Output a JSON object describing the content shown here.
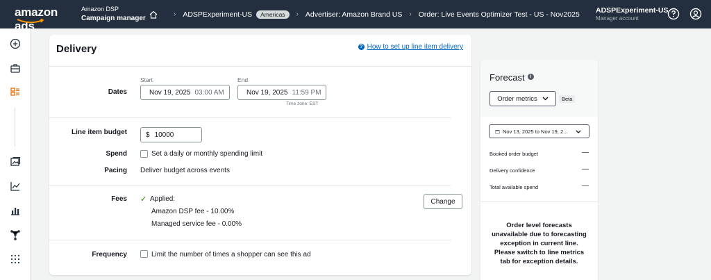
{
  "header": {
    "logo_text": "amazon ads",
    "product_line1": "Amazon DSP",
    "product_line2": "Campaign manager",
    "breadcrumbs": [
      "ADSPExperiment-US",
      "Advertiser: Amazon Brand US",
      "Order: Live Events Optimizer Test - US - Nov2025"
    ],
    "region_pill": "Americas",
    "account_name": "ADSPExperiment-US",
    "account_role": "Manager account"
  },
  "delivery": {
    "title": "Delivery",
    "help_link": "How to set up line item delivery",
    "dates_label": "Dates",
    "start_label": "Start",
    "start_date": "Nov 19, 2025",
    "start_time": "03:00 AM",
    "end_label": "End",
    "end_date": "Nov 19, 2025",
    "end_time": "11:59 PM",
    "timezone": "Time zone: EST",
    "budget_label": "Line item budget",
    "currency": "$",
    "budget_value": "10000",
    "spend_label": "Spend",
    "spend_option": "Set a daily or monthly spending limit",
    "pacing_label": "Pacing",
    "pacing_value": "Deliver budget across events",
    "fees_label": "Fees",
    "fees_status": "Applied:",
    "fee1": "Amazon DSP fee - 10.00%",
    "fee2": "Managed service fee - 0.00%",
    "change_button": "Change",
    "frequency_label": "Frequency",
    "frequency_option": "Limit the number of times a shopper can see this ad"
  },
  "forecast": {
    "title": "Forecast",
    "dropdown": "Order metrics",
    "beta": "Beta",
    "date_range": "Nov 13, 2025 to Nov 19, 2...",
    "metrics": [
      {
        "label": "Booked order budget",
        "value": "—"
      },
      {
        "label": "Delivery confidence",
        "value": "—"
      },
      {
        "label": "Total available spend",
        "value": "—"
      }
    ],
    "message": "Order level forecasts unavailable due to forecasting exception in current line. Please switch to line metrics tab for exception details."
  }
}
